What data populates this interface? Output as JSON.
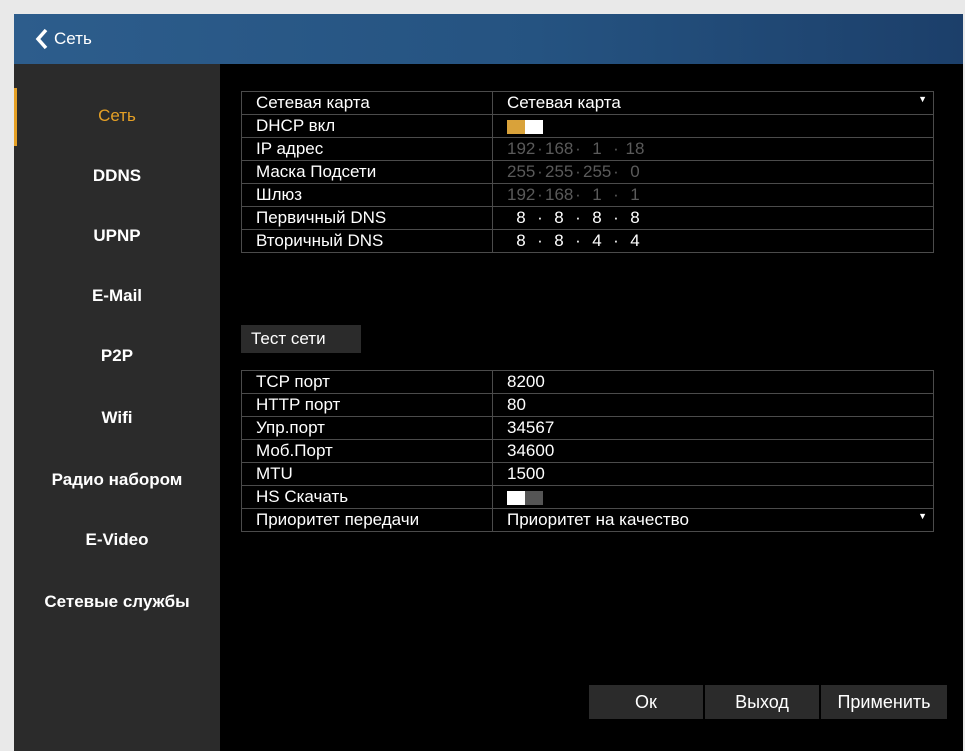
{
  "header": {
    "title": "Сеть"
  },
  "sidebar": {
    "items": [
      {
        "label": "Сеть",
        "active": true
      },
      {
        "label": "DDNS"
      },
      {
        "label": "UPNP"
      },
      {
        "label": "E-Mail"
      },
      {
        "label": "P2P"
      },
      {
        "label": "Wifi"
      },
      {
        "label": "Радио набором"
      },
      {
        "label": "E-Video"
      },
      {
        "label": "Сетевые службы"
      }
    ]
  },
  "network": {
    "card": {
      "label": "Сетевая карта",
      "value": "Сетевая карта"
    },
    "dhcp": {
      "label": "DHCP вкл",
      "on": true
    },
    "ip": {
      "label": "IP адрес",
      "octets": [
        "192",
        "168",
        "1",
        "18"
      ]
    },
    "mask": {
      "label": "Маска Подсети",
      "octets": [
        "255",
        "255",
        "255",
        "0"
      ]
    },
    "gateway": {
      "label": "Шлюз",
      "octets": [
        "192",
        "168",
        "1",
        "1"
      ]
    },
    "dns1": {
      "label": "Первичный DNS",
      "octets": [
        "8",
        "8",
        "8",
        "8"
      ]
    },
    "dns2": {
      "label": "Вторичный DNS",
      "octets": [
        "8",
        "8",
        "4",
        "4"
      ]
    }
  },
  "test_button": "Тест сети",
  "ports": {
    "tcp": {
      "label": "TCP порт",
      "value": "8200"
    },
    "http": {
      "label": "HTTP порт",
      "value": "80"
    },
    "ctrl": {
      "label": "Упр.порт",
      "value": "34567"
    },
    "mob": {
      "label": "Моб.Порт",
      "value": "34600"
    },
    "mtu": {
      "label": "MTU",
      "value": "1500"
    },
    "hs": {
      "label": "HS Скачать",
      "on": false
    },
    "priority": {
      "label": "Приоритет передачи",
      "value": "Приоритет на качество"
    }
  },
  "buttons": {
    "ok": "Ок",
    "exit": "Выход",
    "apply": "Применить"
  },
  "colors": {
    "accent": "#e5a025",
    "header": "#255381",
    "panel": "#2b2b2b",
    "background": "#000000"
  }
}
